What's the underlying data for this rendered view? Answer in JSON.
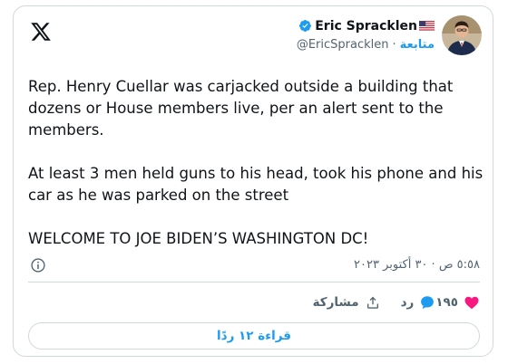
{
  "author": {
    "name": "Eric Spracklen",
    "handle": "@EricSpracklen",
    "follow_label": "متابعة",
    "separator": "·"
  },
  "tweet": {
    "paragraphs": [
      "Rep. Henry Cuellar was carjacked outside a building that dozens or House members live, per an alert sent to the members.",
      "At least 3 men held guns to his head, took his phone and his car as he was parked on the street",
      "WELCOME TO JOE BIDEN’S WASHINGTON DC!"
    ],
    "timestamp": "٥:٥٨ ص · ٣٠ أكتوبر ٢٠٢٣"
  },
  "actions": {
    "like_count": "١٩٥",
    "reply_label": "رد",
    "share_label": "مشاركة"
  },
  "read_replies_label": "قراءة ١٢ ردًا",
  "icons": {
    "logo": "x-logo-icon",
    "verified": "verified-badge-icon",
    "flag": "us-flag-icon",
    "info": "info-icon",
    "like": "heart-icon",
    "reply": "reply-bubble-icon",
    "share": "share-upload-icon"
  },
  "colors": {
    "accent": "#1d9bf0",
    "like": "#f91880",
    "text": "#0f1419",
    "muted": "#536471",
    "border": "#cfd9de"
  }
}
